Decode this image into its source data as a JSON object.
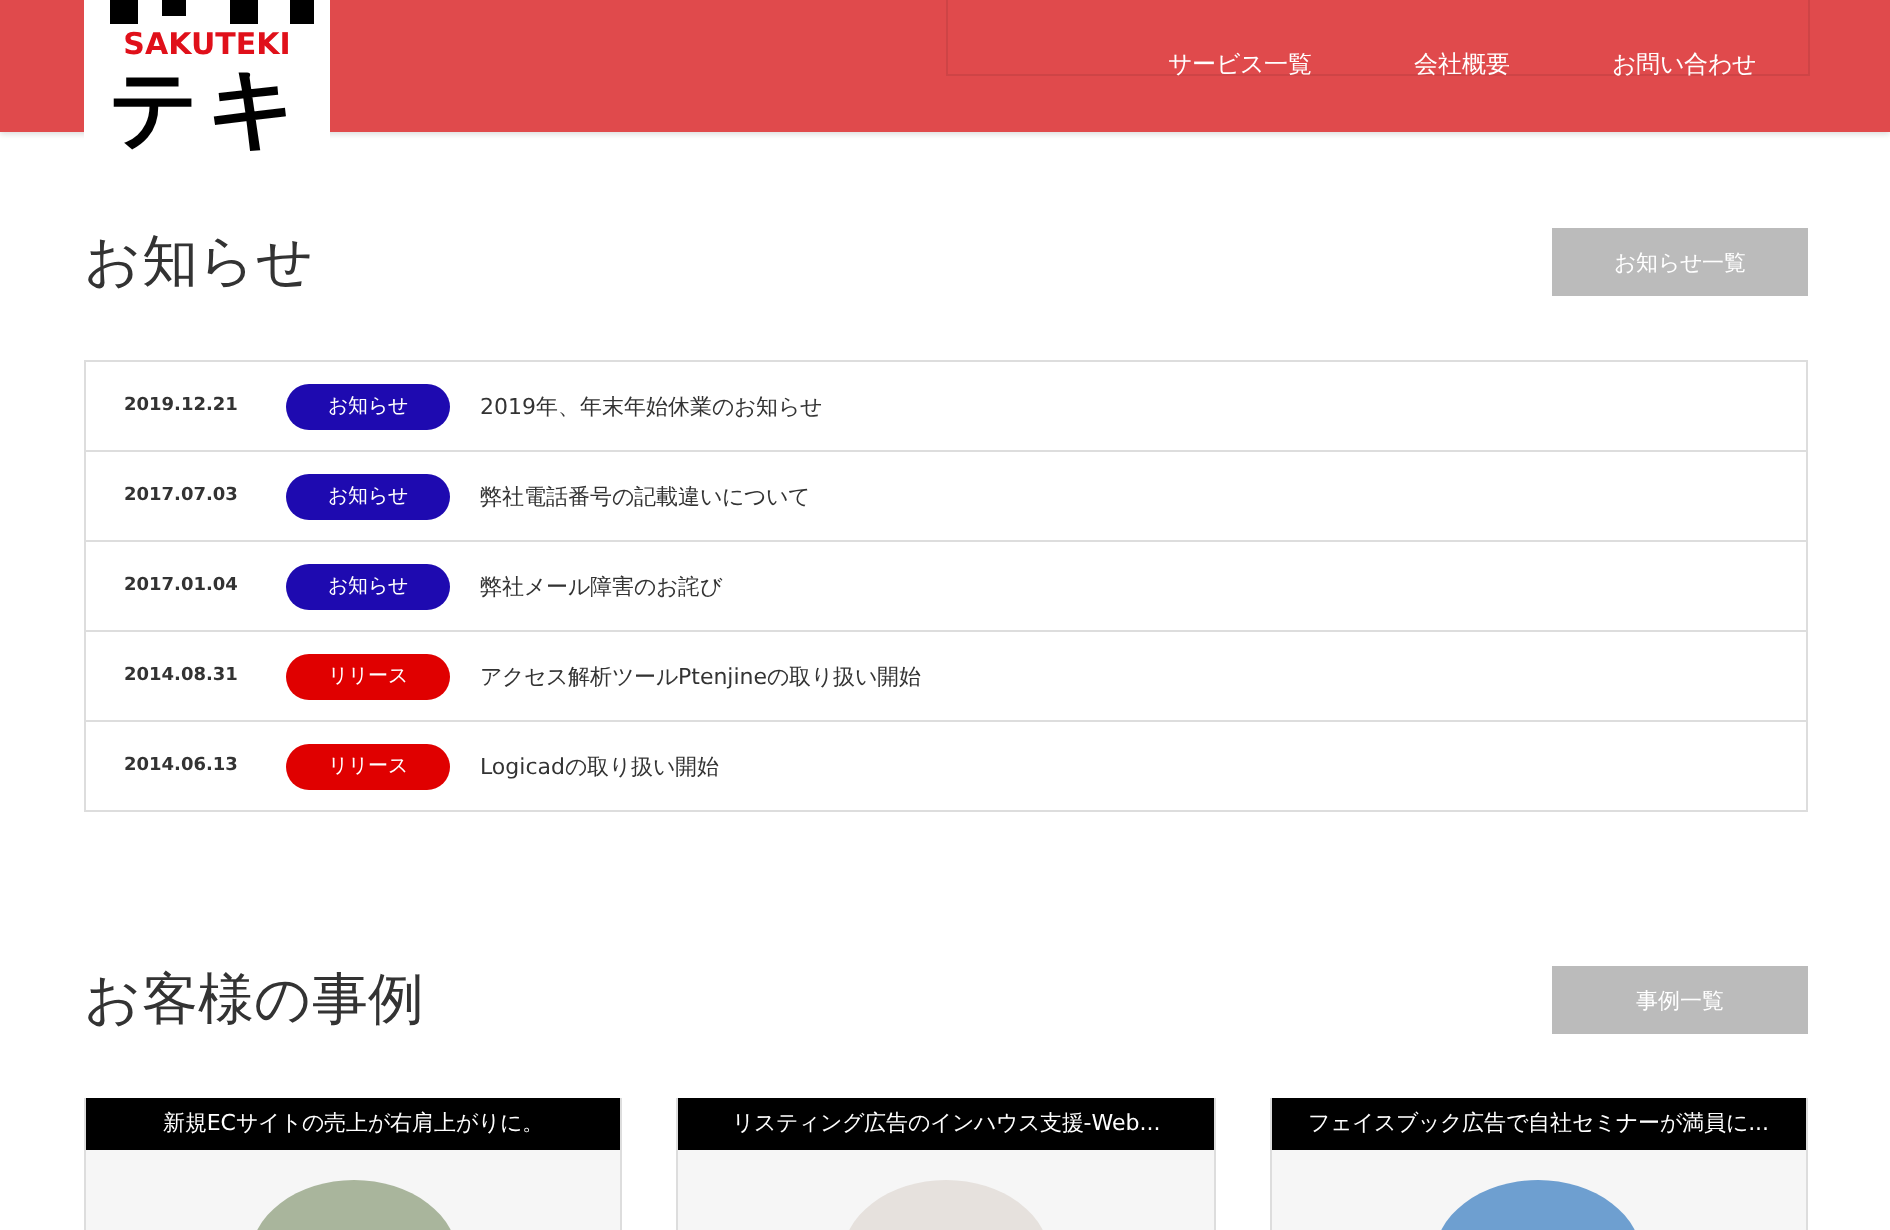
{
  "logo": {
    "wordmark": "SAKUTEKI",
    "katakana": "テキ"
  },
  "nav": [
    {
      "label": "サービス一覧"
    },
    {
      "label": "会社概要"
    },
    {
      "label": "お問い合わせ"
    }
  ],
  "news": {
    "title": "お知らせ",
    "more_button": "お知らせ一覧",
    "items": [
      {
        "date": "2019.12.21",
        "tag": "お知らせ",
        "kind": "notice",
        "text": "2019年、年末年始休業のお知らせ"
      },
      {
        "date": "2017.07.03",
        "tag": "お知らせ",
        "kind": "notice",
        "text": "弊社電話番号の記載違いについて"
      },
      {
        "date": "2017.01.04",
        "tag": "お知らせ",
        "kind": "notice",
        "text": "弊社メール障害のお詫び"
      },
      {
        "date": "2014.08.31",
        "tag": "リリース",
        "kind": "release",
        "text": "アクセス解析ツールPtenjineの取り扱い開始"
      },
      {
        "date": "2014.06.13",
        "tag": "リリース",
        "kind": "release",
        "text": "Logicadの取り扱い開始"
      }
    ]
  },
  "cases": {
    "title": "お客様の事例",
    "more_button": "事例一覧",
    "cards": [
      {
        "title": "新規ECサイトの売上が右肩上がりに。"
      },
      {
        "title": "リスティング広告のインハウス支援-Web..."
      },
      {
        "title": "フェイスブック広告で自社セミナーが満員に..."
      }
    ]
  }
}
